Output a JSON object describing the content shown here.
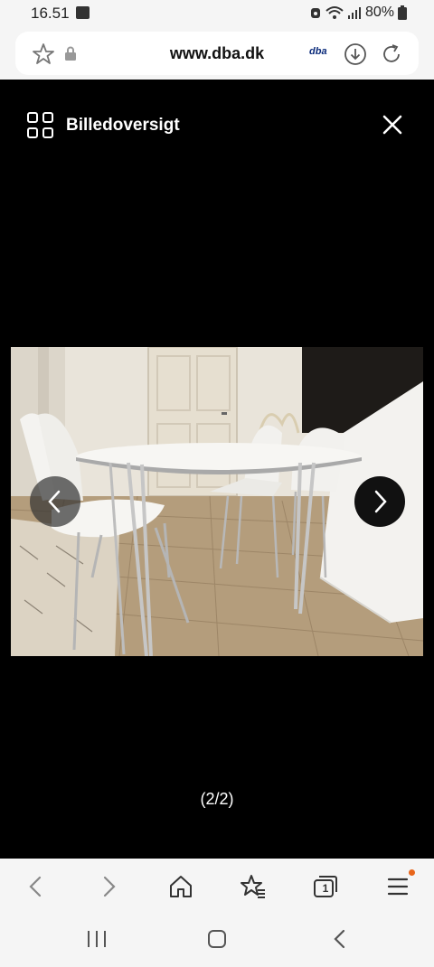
{
  "status_bar": {
    "time": "16.51",
    "battery": "80%"
  },
  "browser": {
    "url": "www.dba.dk",
    "site_badge": "dba"
  },
  "viewer": {
    "title": "Billedoversigt",
    "counter": "(2/2)"
  },
  "toolbar": {
    "items": [
      "back-icon",
      "forward-icon",
      "home-icon",
      "bookmarks-icon",
      "tabs-icon",
      "menu-icon"
    ],
    "tab_count": "1",
    "notification_color": "#e8651a"
  },
  "system_nav": {
    "items": [
      "recents-icon",
      "home-icon",
      "back-icon"
    ]
  }
}
